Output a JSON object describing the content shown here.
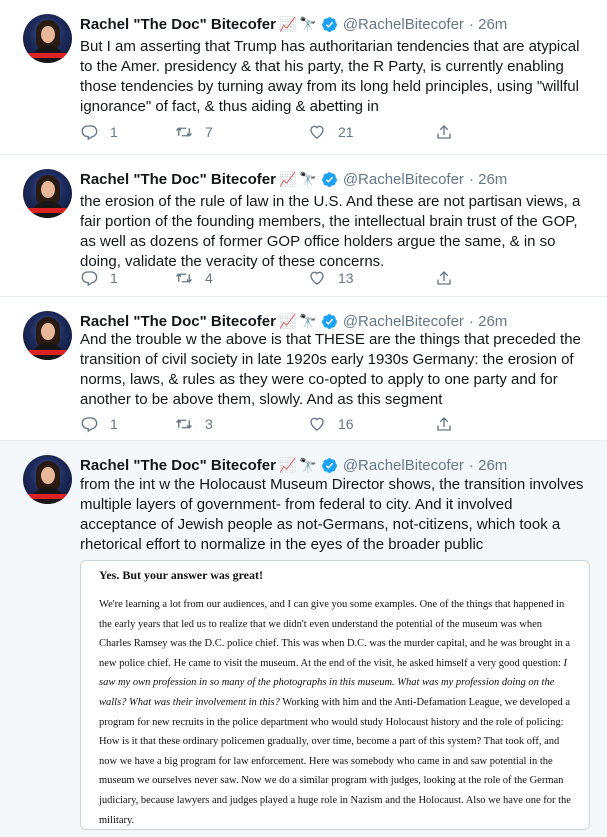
{
  "colors": {
    "accent": "#1da1f2",
    "text": "#14171a",
    "muted": "#657786",
    "verified": "#1da1f2"
  },
  "tweets": [
    {
      "name": "Rachel \"The Doc\" Bitecofer",
      "emoji": [
        "📈",
        "🔭"
      ],
      "handle": "@RachelBitecofer",
      "time": "· 26m",
      "text": "But I am asserting that Trump has authoritarian tendencies that are atypical to the Amer. presidency & that his party, the R Party, is currently enabling those tendencies by turning away from its long held principles, using \"willful ignorance\" of fact, & thus aiding & abetting in",
      "replies": "1",
      "retweets": "7",
      "likes": "21"
    },
    {
      "name": "Rachel \"The Doc\" Bitecofer",
      "emoji": [
        "📈",
        "🔭"
      ],
      "handle": "@RachelBitecofer",
      "time": "· 26m",
      "text": "the erosion of the rule of law in the U.S. And these are not partisan views, a fair portion of the founding members, the intellectual brain trust of the GOP, as well as dozens of former GOP office holders argue the same, & in so doing, validate the veracity of these concerns.",
      "replies": "1",
      "retweets": "4",
      "likes": "13"
    },
    {
      "name": "Rachel \"The Doc\" Bitecofer",
      "emoji": [
        "📈",
        "🔭"
      ],
      "handle": "@RachelBitecofer",
      "time": "· 26m",
      "text": "And the trouble w the above is that THESE are the things that preceded the transition of civil society in late 1920s early 1930s Germany: the erosion of norms, laws, & rules as they were co-opted to apply to one party and for another to be above them, slowly. And as this segment",
      "replies": "1",
      "retweets": "3",
      "likes": "16"
    },
    {
      "name": "Rachel \"The Doc\" Bitecofer",
      "emoji": [
        "📈",
        "🔭"
      ],
      "handle": "@RachelBitecofer",
      "time": "· 26m",
      "text": "from the int w the Holocaust Museum Director shows, the transition involves multiple layers of government- from federal to city. And it involved acceptance of Jewish people as not-Germans, not-citizens, which took a rhetorical effort to normalize in the eyes of the broader public"
    }
  ],
  "quote": {
    "heading": "Yes. But your answer was great!",
    "body_start": "We're learning a lot from our audiences, and I can give you some examples. One of the things that happened in the early years that led us to realize that we didn't even understand the potential of the museum was when Charles Ramsey was the D.C. police chief. This was when D.C. was the murder capital, and he was brought in a new police chief. He came to visit the museum. At the end of the visit, he asked himself a very good question: ",
    "body_italic": "I saw my own profession in so many of the photographs in this museum. What was my profession doing on the walls? What was their involvement in this?",
    "body_end": " Working with him and the Anti-Defamation League, we developed a program for new recruits in the police department who would study Holocaust history and the role of policing: How is it that these ordinary policemen gradually, over time, become a part of this system? That took off, and now we have a big program for law enforcement. Here was somebody who came in and saw potential in the museum we ourselves never saw. Now we do a similar program with judges, looking at the role of the German judiciary, because lawyers and judges played a huge role in Nazism and the Holocaust. Also we have one for the military."
  }
}
